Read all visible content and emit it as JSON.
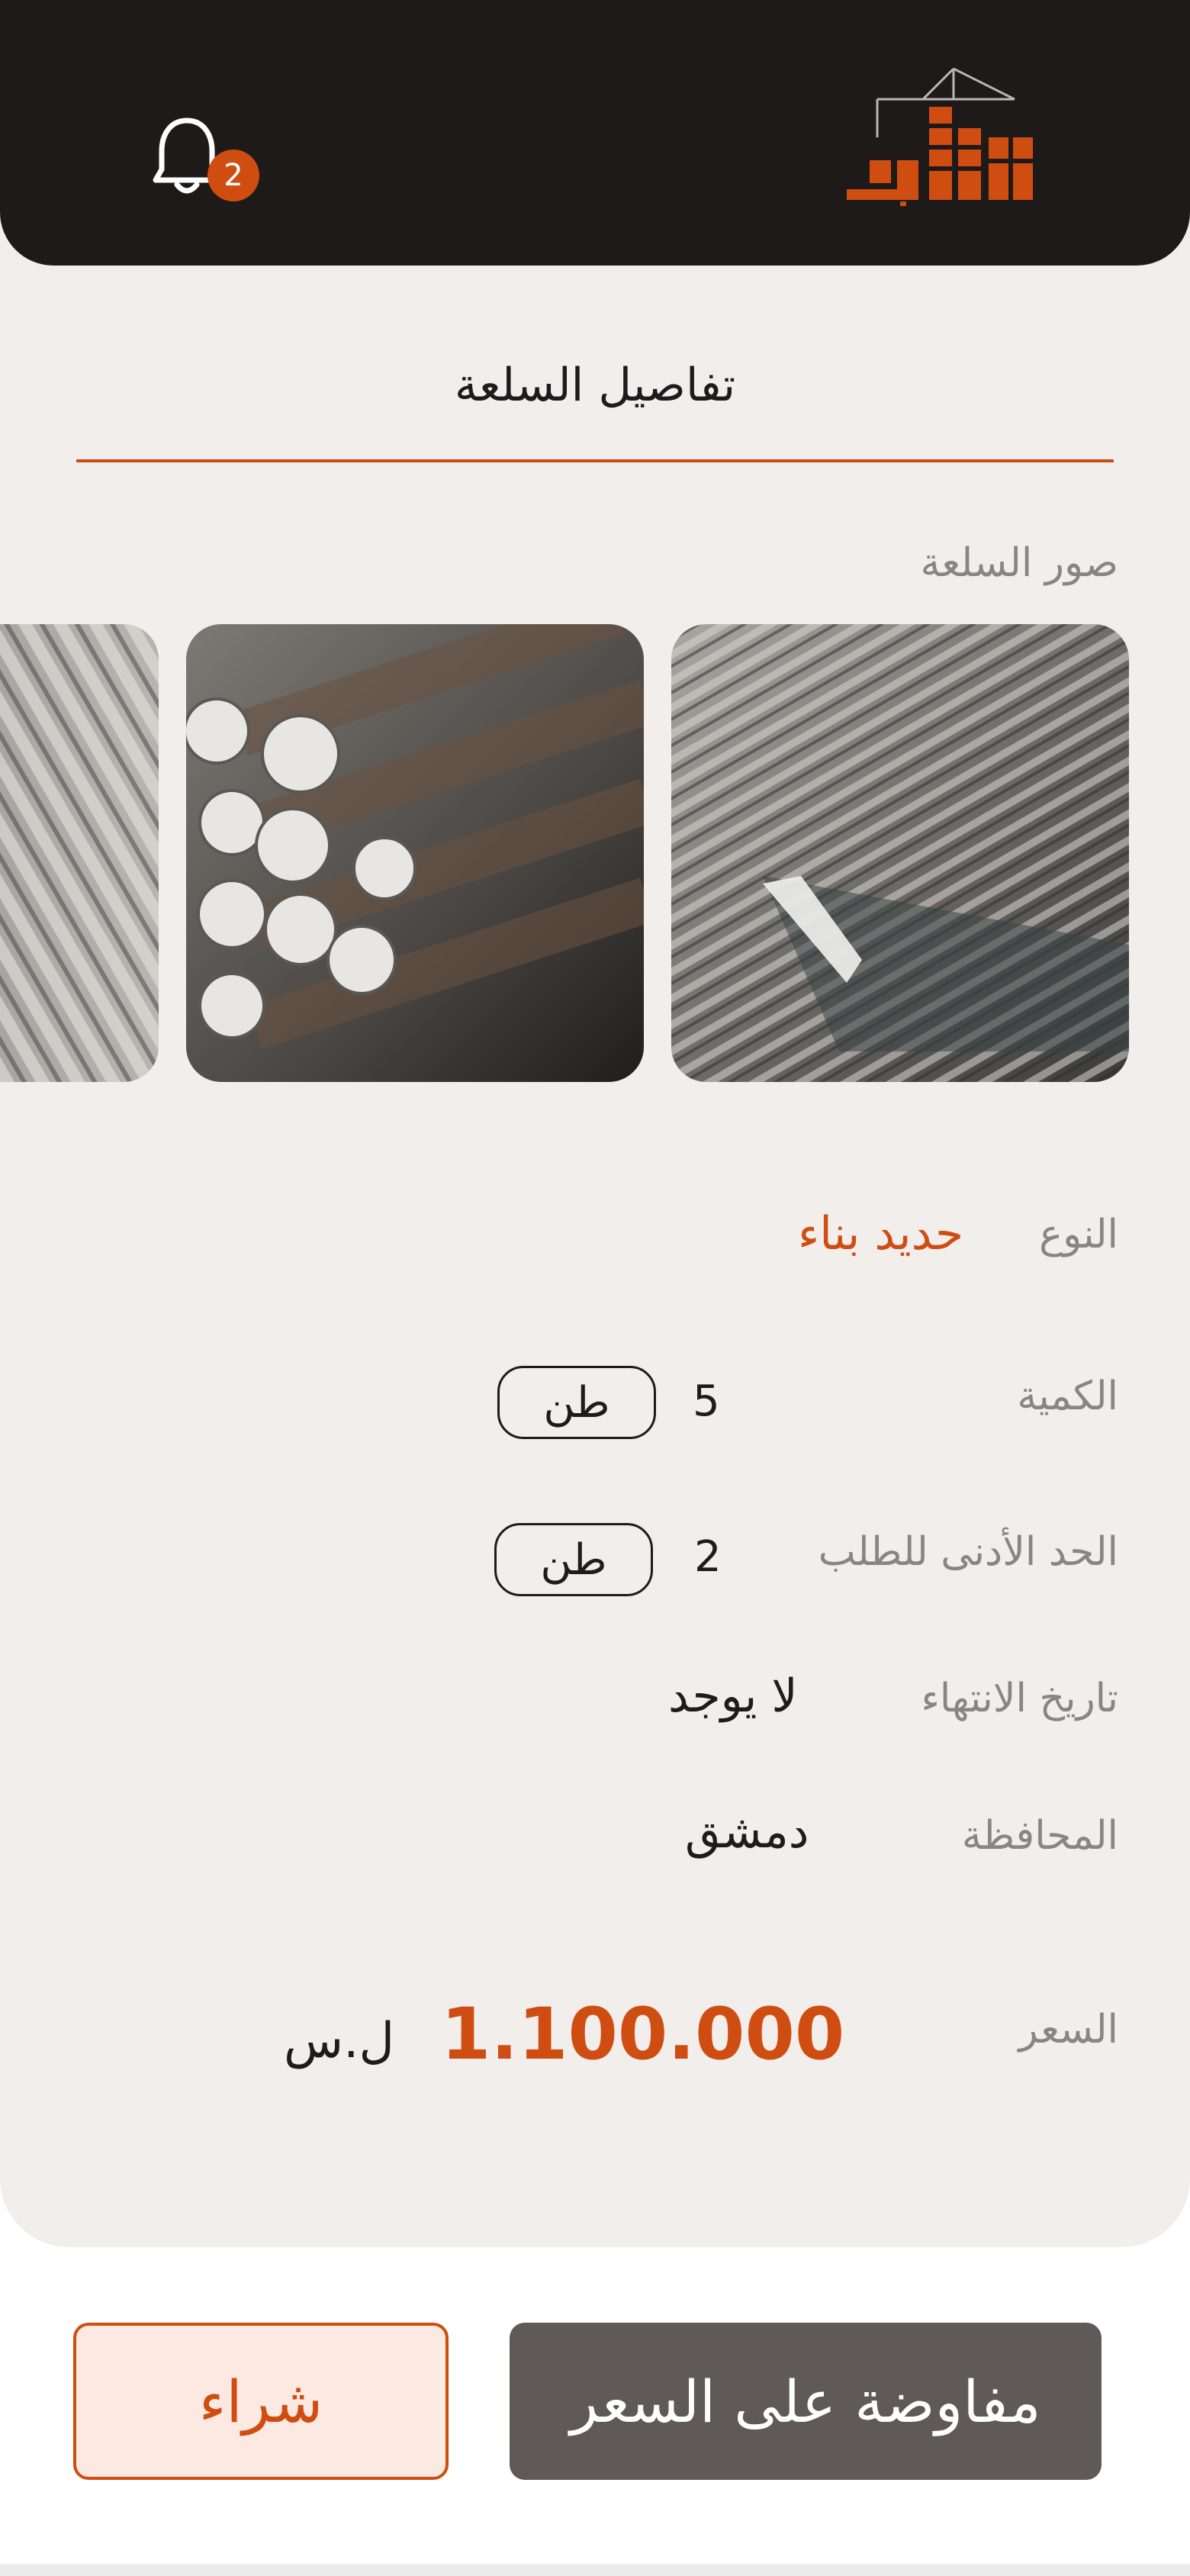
{
  "header": {
    "notifications_count": "2",
    "logo_icon": "crane-brick-logo"
  },
  "page": {
    "title": "تفاصيل السلعة",
    "images_label": "صور السلعة"
  },
  "gallery": {
    "photos": [
      "rebar-bundle-photo",
      "rebar-ends-photo",
      "rebar-stack-photo"
    ]
  },
  "details": {
    "type_label": "النوع",
    "type_value": "حديد بناء",
    "quantity_label": "الكمية",
    "quantity_value": "5",
    "quantity_unit": "طن",
    "min_order_label": "الحد الأدنى للطلب",
    "min_order_value": "2",
    "min_order_unit": "طن",
    "expiry_label": "تاريخ الانتهاء",
    "expiry_value": "لا يوجد",
    "governorate_label": "المحافظة",
    "governorate_value": "دمشق",
    "price_label": "السعر",
    "price_value": "1.100.000",
    "currency": "ل.س"
  },
  "actions": {
    "buy_label": "شراء",
    "negotiate_label": "مفاوضة على السعر"
  },
  "colors": {
    "accent": "#d04d12",
    "header_bg": "#1e1a19",
    "card_bg": "#f1eeec",
    "secondary_button": "#5f5a57"
  }
}
